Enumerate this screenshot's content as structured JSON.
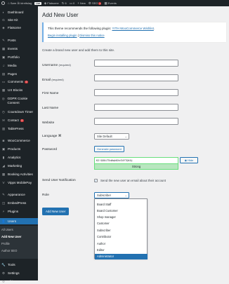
{
  "adminbar": {
    "site_name": "Søre Ål idrettslag",
    "live_badge": "Live",
    "updates": "6",
    "comments": "0",
    "new_label": "New",
    "seo_label": "SEO",
    "seo_badge": "1",
    "events_label": "Events"
  },
  "sidebar": {
    "items": [
      {
        "label": "Dashboard",
        "icon": "dashboard-icon"
      },
      {
        "label": "Site Kit",
        "icon": "sitekit-icon"
      },
      {
        "label": "Flatsome",
        "icon": "flatsome-icon"
      },
      {
        "label": "Posts",
        "icon": "posts-icon"
      },
      {
        "label": "Events",
        "icon": "events-icon"
      },
      {
        "label": "Portfolio",
        "icon": "portfolio-icon"
      },
      {
        "label": "Media",
        "icon": "media-icon"
      },
      {
        "label": "Pages",
        "icon": "pages-icon"
      },
      {
        "label": "Comments",
        "icon": "comments-icon",
        "badge": "0"
      },
      {
        "label": "UX Blocks",
        "icon": "uxblocks-icon"
      },
      {
        "label": "GDPR Cookie Consent",
        "icon": "gdpr-icon"
      },
      {
        "label": "Countdown Timer",
        "icon": "countdown-icon"
      },
      {
        "label": "Contact",
        "icon": "contact-icon",
        "badge": "3"
      },
      {
        "label": "TablePress",
        "icon": "tablepress-icon"
      },
      {
        "label": "WooCommerce",
        "icon": "woocommerce-icon"
      },
      {
        "label": "Products",
        "icon": "products-icon"
      },
      {
        "label": "Analytics",
        "icon": "analytics-icon"
      },
      {
        "label": "Marketing",
        "icon": "marketing-icon"
      },
      {
        "label": "Booking Activities",
        "icon": "booking-icon"
      },
      {
        "label": "Vipps MobilePay",
        "icon": "vipps-icon"
      },
      {
        "label": "Appearance",
        "icon": "appearance-icon"
      },
      {
        "label": "EmbedPress",
        "icon": "embedpress-icon"
      },
      {
        "label": "Plugins",
        "icon": "plugins-icon"
      },
      {
        "label": "Users",
        "icon": "users-icon"
      },
      {
        "label": "Tools",
        "icon": "tools-icon"
      },
      {
        "label": "Settings",
        "icon": "settings-icon"
      },
      {
        "label": "All in One SEO",
        "icon": "aioseo-icon"
      },
      {
        "label": "Tr Plugin Feed",
        "icon": "feed-icon"
      }
    ],
    "submenu": [
      "All Users",
      "Add New User",
      "Profile",
      "Author SEO"
    ]
  },
  "main": {
    "title": "Add New User",
    "notice_text": "This theme recommends the following plugin: ",
    "notice_plugin": "YITH WooCommerce Wishlist",
    "notice_begin": "Begin installing plugin",
    "notice_sep": " | ",
    "notice_dismiss": "Dismiss this notice",
    "intro": "Create a brand new user and add them to this site.",
    "fields": {
      "username": "Username",
      "email": "Email",
      "required": "(required)",
      "first_name": "First Name",
      "last_name": "Last Name",
      "website": "Website",
      "language": "Language",
      "language_value": "Site Default",
      "password": "Password",
      "generate_password": "Generate password",
      "password_value": "K2!$8UiT5d#qh0Xe34YT@4Oj",
      "hide_label": "Hide",
      "strength": "Strong",
      "notification": "Send User Notification",
      "notification_text": "Send the new user an email about their account",
      "role": "Role",
      "role_value": "Subscriber"
    },
    "role_options": [
      "Board Staff",
      "Board Customer",
      "Shop manager",
      "Customer",
      "Subscriber",
      "Contributor",
      "Author",
      "Editor",
      "Administrator"
    ],
    "role_selected_index": 8,
    "submit": "Add New User"
  },
  "colors": {
    "accent": "#2271b1",
    "sidebar_bg": "#1d2327",
    "strong_bg": "#b8e6bf",
    "badge_red": "#d63638"
  }
}
